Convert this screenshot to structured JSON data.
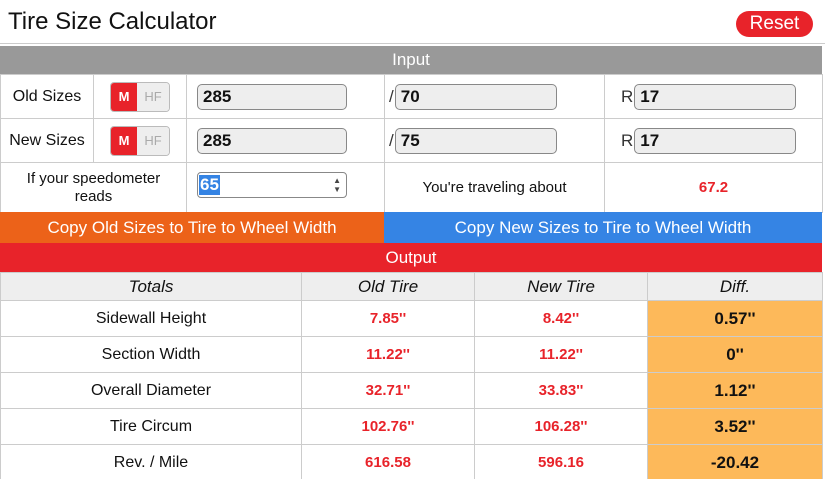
{
  "app": {
    "title": "Tire Size Calculator",
    "reset_label": "Reset"
  },
  "input": {
    "header": "Input",
    "rows": [
      {
        "label": "Old Sizes",
        "toggle_on": "M",
        "toggle_off": "HF",
        "width": "285",
        "aspect_prefix": "/",
        "aspect": "70",
        "rim_prefix": "R",
        "rim": "17"
      },
      {
        "label": "New Sizes",
        "toggle_on": "M",
        "toggle_off": "HF",
        "width": "285",
        "aspect_prefix": "/",
        "aspect": "75",
        "rim_prefix": "R",
        "rim": "17"
      }
    ],
    "speedometer": {
      "label": "If your speedometer reads",
      "value": "65",
      "traveling_label": "You're traveling about",
      "traveling_value": "67.2"
    }
  },
  "copy_buttons": {
    "old": "Copy Old Sizes to Tire to Wheel Width",
    "new": "Copy New Sizes to Tire to Wheel Width"
  },
  "output": {
    "header": "Output",
    "columns": [
      "Totals",
      "Old Tire",
      "New Tire",
      "Diff."
    ],
    "rows": [
      {
        "label": "Sidewall Height",
        "old": "7.85''",
        "new": "8.42''",
        "diff": "0.57''"
      },
      {
        "label": "Section Width",
        "old": "11.22''",
        "new": "11.22''",
        "diff": "0''"
      },
      {
        "label": "Overall Diameter",
        "old": "32.71''",
        "new": "33.83''",
        "diff": "1.12''"
      },
      {
        "label": "Tire Circum",
        "old": "102.76''",
        "new": "106.28''",
        "diff": "3.52''"
      },
      {
        "label": "Rev. / Mile",
        "old": "616.58",
        "new": "596.16",
        "diff": "-20.42"
      }
    ]
  },
  "colors": {
    "accent_red": "#e8232a",
    "copy_old_orange": "#ec6219",
    "copy_new_blue": "#3584e4",
    "diff_highlight": "#fdb95a"
  }
}
